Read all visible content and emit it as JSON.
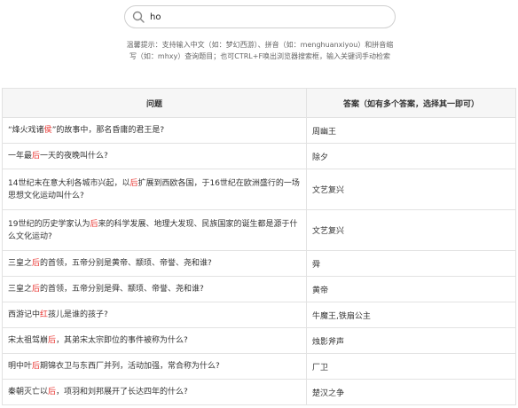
{
  "search": {
    "value": "ho",
    "placeholder": ""
  },
  "tips": {
    "line1": "温馨提示：支持输入中文（如：梦幻西游）、拼音（如：menghuanxiyou）和拼音缩",
    "line2": "写（如：mhxy）查询题目；也可CTRL+F唤出浏览器搜索框，输入关键词手动检索"
  },
  "table": {
    "headers": {
      "question": "问题",
      "answer": "答案（如有多个答案，选择其一即可）"
    },
    "rows": [
      {
        "q_pre": "“烽火戏诸",
        "q_hl": "侯",
        "q_post": "”的故事中，那名昏庸的君王是?",
        "answer": "周幽王"
      },
      {
        "q_pre": "一年最",
        "q_hl": "后",
        "q_post": "一天的夜晚叫什么?",
        "answer": "除夕"
      },
      {
        "q_pre": "14世纪末在意大利各城市兴起，以",
        "q_hl": "后",
        "q_post": "扩展到西欧各国，于16世纪在欧洲盛行的一场思想文化运动叫什么?",
        "answer": "文艺复兴"
      },
      {
        "q_pre": "19世纪的历史学家认为",
        "q_hl": "后",
        "q_post": "来的科学发展、地理大发现、民族国家的诞生都是源于什么文化运动?",
        "answer": "文艺复兴"
      },
      {
        "q_pre": "三皇之",
        "q_hl": "后",
        "q_post": "的首领，五帝分别是黄帝、颛顼、帝誉、尧和谁?",
        "answer": "舜"
      },
      {
        "q_pre": "三皇之",
        "q_hl": "后",
        "q_post": "的首领，五帝分别是舜、颛顼、帝誉、尧和谁?",
        "answer": "黄帝"
      },
      {
        "q_pre": "西游记中",
        "q_hl": "红",
        "q_post": "孩儿是谁的孩子?",
        "answer": "牛魔王,铁扇公主"
      },
      {
        "q_pre": "宋太祖驾崩",
        "q_hl": "后",
        "q_post": "，其弟宋太宗即位的事件被称为什么?",
        "answer": "烛影斧声"
      },
      {
        "q_pre": "明中叶",
        "q_hl": "后",
        "q_post": "期锦衣卫与东西厂并列，活动加强，常合称为什么?",
        "answer": "厂卫"
      },
      {
        "q_pre": "秦朝灭亡以",
        "q_hl": "后",
        "q_post": "，项羽和刘邦展开了长达四年的什么?",
        "answer": "楚汉之争"
      }
    ]
  }
}
